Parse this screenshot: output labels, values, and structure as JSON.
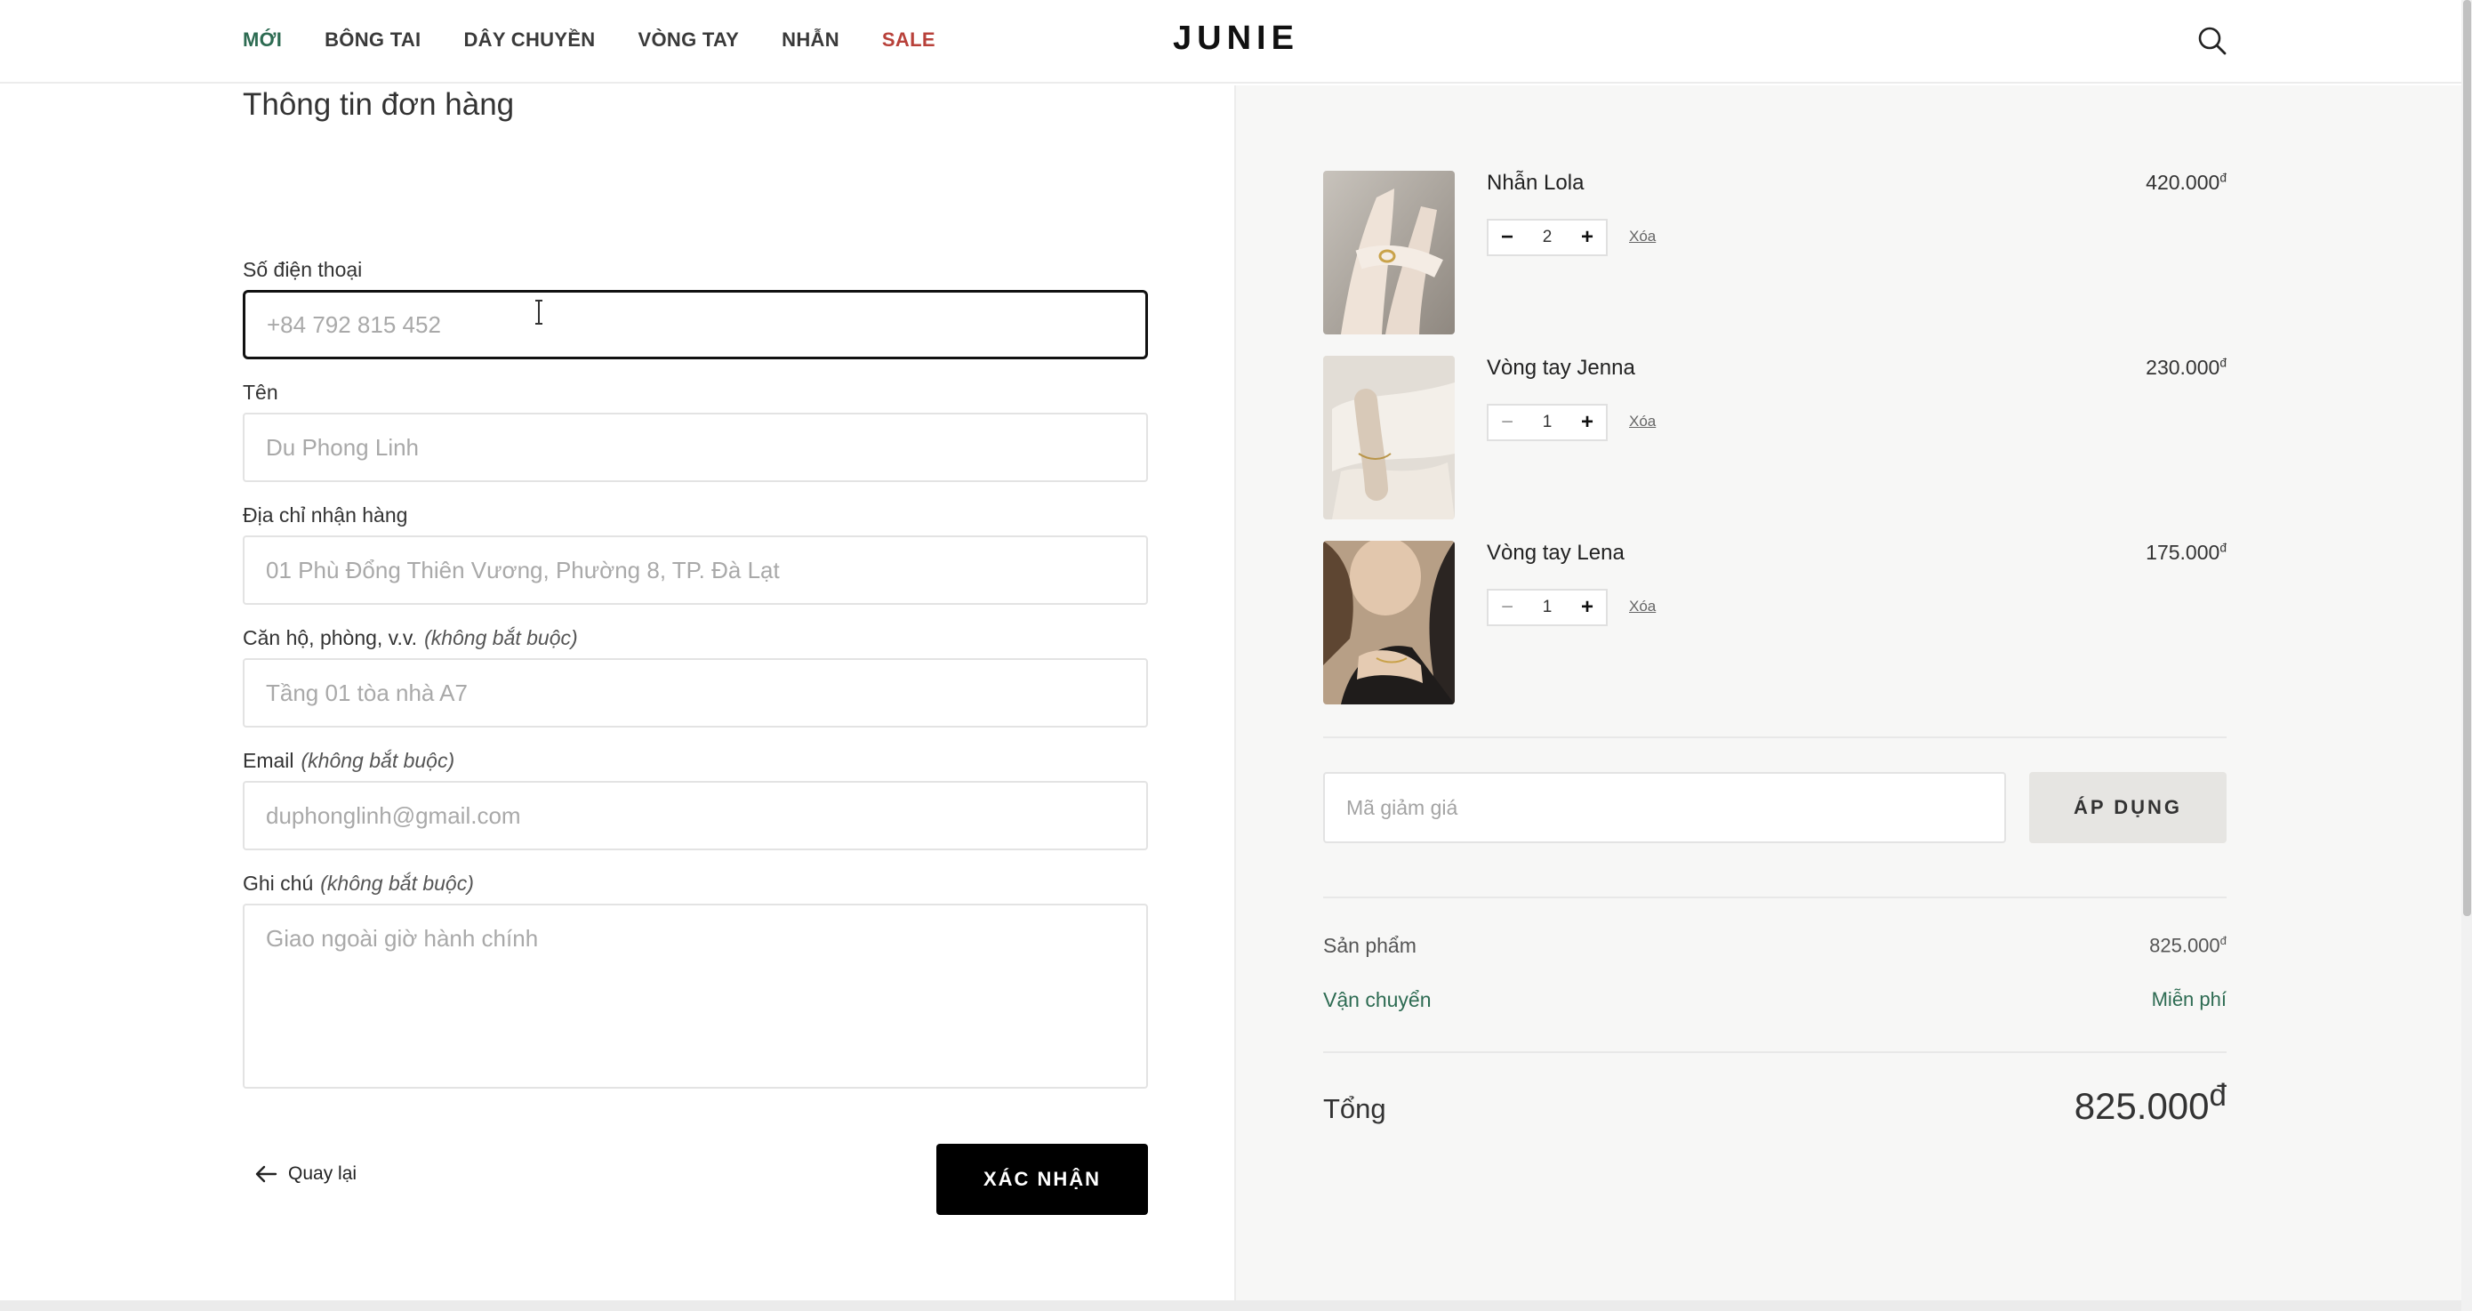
{
  "header": {
    "nav": [
      {
        "label": "MỚI"
      },
      {
        "label": "BÔNG TAI"
      },
      {
        "label": "DÂY CHUYỀN"
      },
      {
        "label": "VÒNG TAY"
      },
      {
        "label": "NHẪN"
      },
      {
        "label": "SALE"
      }
    ],
    "logo": "JUNIE",
    "colors": {
      "new": "#2d6b52",
      "sale": "#b8413a"
    }
  },
  "form": {
    "title": "Thông tin đơn hàng",
    "optional_note": "(không bắt buộc)",
    "phone": {
      "label": "Số điện thoại",
      "placeholder": "+84 792 815 452"
    },
    "name": {
      "label": "Tên",
      "placeholder": "Du Phong Linh"
    },
    "address": {
      "label": "Địa chỉ nhận hàng",
      "placeholder": "01 Phù Đổng Thiên Vương, Phường 8, TP. Đà Lạt"
    },
    "apartment": {
      "label": "Căn hộ, phòng, v.v.",
      "placeholder": "Tầng 01 tòa nhà A7"
    },
    "email": {
      "label": "Email",
      "placeholder": "duphonglinh@gmail.com"
    },
    "note": {
      "label": "Ghi chú",
      "placeholder": "Giao ngoài giờ hành chính"
    },
    "back_label": "Quay lại",
    "confirm_label": "XÁC NHẬN"
  },
  "cart": {
    "items": [
      {
        "name": "Nhẫn Lola",
        "price": "420.000",
        "qty": "2",
        "remove": "Xóa"
      },
      {
        "name": "Vòng tay Jenna",
        "price": "230.000",
        "qty": "1",
        "remove": "Xóa"
      },
      {
        "name": "Vòng tay Lena",
        "price": "175.000",
        "qty": "1",
        "remove": "Xóa"
      }
    ],
    "currency": "đ",
    "coupon_placeholder": "Mã giảm giá",
    "apply_label": "ÁP DỤNG",
    "subtotal_label": "Sản phẩm",
    "subtotal_value": "825.000",
    "shipping_label": "Vận chuyển",
    "shipping_value": "Miễn phí",
    "total_label": "Tổng",
    "total_value": "825.000",
    "shipping_color": "#2d6b52"
  }
}
